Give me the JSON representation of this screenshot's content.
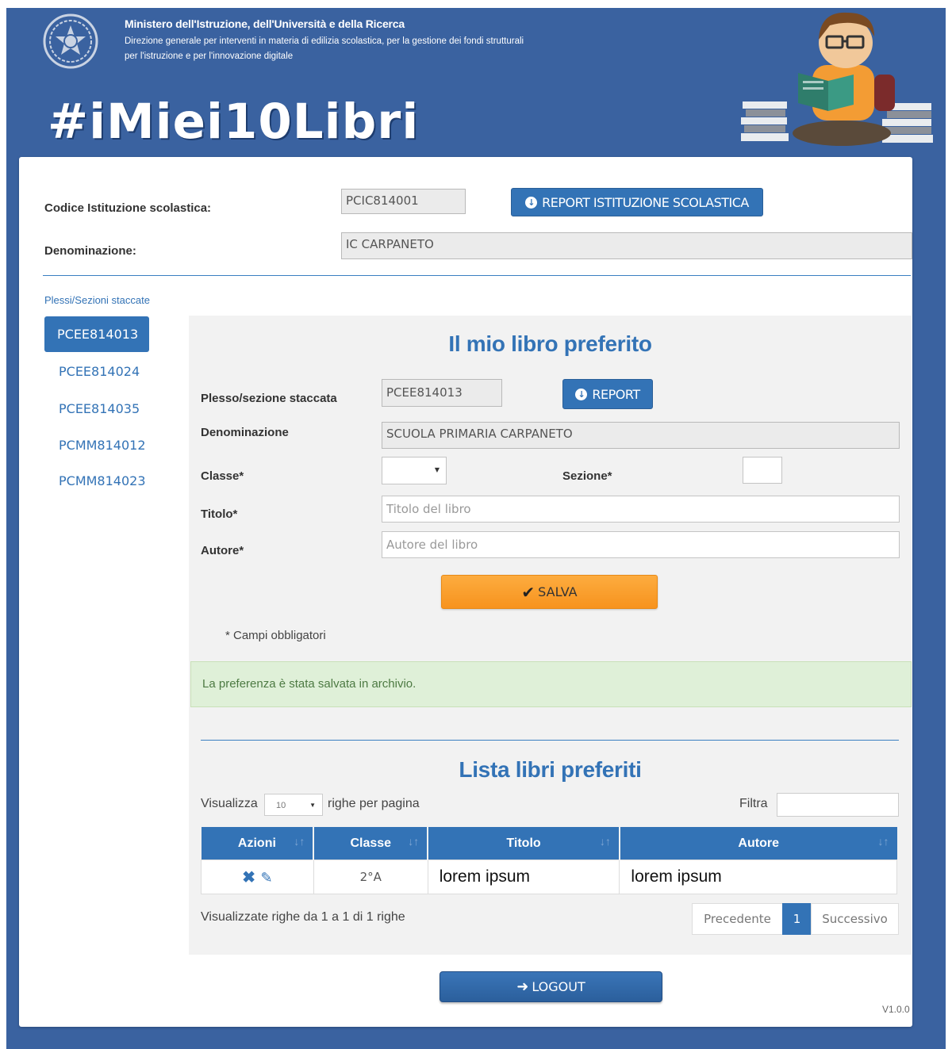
{
  "header": {
    "ministry": "Ministero dell'Istruzione, dell'Università e della Ricerca",
    "directorate": "Direzione generale per interventi in materia di edilizia scolastica, per la gestione dei fondi strutturali per l'istruzione e per l'innovazione digitale",
    "brand": "#iMiei10Libri"
  },
  "school": {
    "codice_label": "Codice Istituzione scolastica:",
    "codice_value": "PCIC814001",
    "report_button": "REPORT ISTITUZIONE SCOLASTICA",
    "denominazione_label": "Denominazione:",
    "denominazione_value": "IC CARPANETO"
  },
  "plessi": {
    "title": "Plessi/Sezioni staccate",
    "items": [
      "PCEE814013",
      "PCEE814024",
      "PCEE814035",
      "PCMM814012",
      "PCMM814023"
    ]
  },
  "form": {
    "title": "Il mio libro preferito",
    "plesso_label": "Plesso/sezione staccata",
    "plesso_value": "PCEE814013",
    "report_button": "REPORT",
    "denominazione_label": "Denominazione",
    "denominazione_value": "SCUOLA PRIMARIA CARPANETO",
    "classe_label": "Classe*",
    "classe_value": "",
    "sezione_label": "Sezione*",
    "sezione_value": "",
    "titolo_label": "Titolo*",
    "titolo_placeholder": "Titolo del libro",
    "autore_label": "Autore*",
    "autore_placeholder": "Autore del libro",
    "salva_button": "SALVA",
    "required_note": "* Campi obbligatori",
    "success_message": "La preferenza è stata salvata in archivio."
  },
  "list": {
    "title": "Lista libri preferiti",
    "show_prefix": "Visualizza",
    "show_value": "10",
    "show_suffix": "righe per pagina",
    "filter_label": "Filtra",
    "columns": [
      "Azioni",
      "Classe",
      "Titolo",
      "Autore"
    ],
    "rows": [
      {
        "classe": "2°A",
        "titolo": "lorem ipsum",
        "autore": "lorem ipsum"
      }
    ],
    "info": "Visualizzate righe da 1 a 1 di 1 righe",
    "pager": {
      "prev": "Precedente",
      "current": "1",
      "next": "Successivo"
    }
  },
  "logout_button": "LOGOUT",
  "version": "V1.0.0",
  "colors": {
    "primary": "#3373b6",
    "header_bg": "#3a62a0",
    "save": "#f7931e",
    "success_bg": "#dff0d8"
  },
  "icons": [
    "emblem-icon",
    "download-circle-icon",
    "checkmark-icon",
    "delete-icon",
    "edit-icon",
    "sort-icon",
    "logout-icon",
    "caret-down-icon"
  ]
}
